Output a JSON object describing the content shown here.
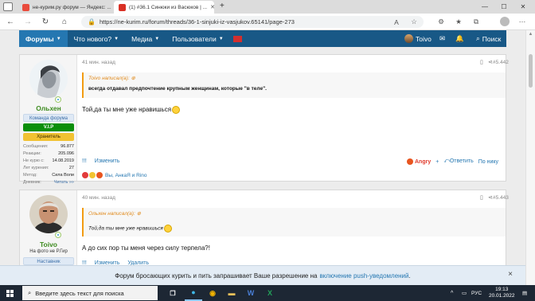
{
  "browser": {
    "tabs": [
      {
        "title": "не-курим.ру форум — Яндекс: ...",
        "active": false
      },
      {
        "title": "(1) #36.1 Синюки из Васюков | ...",
        "active": true
      }
    ],
    "new_tab": "+",
    "url": "https://ne-kurim.ru/forum/threads/36-1-sinjuki-iz-vasjukov.65141/page-273"
  },
  "site_nav": {
    "items": [
      "Форумы",
      "Что нового?",
      "Медиа",
      "Пользователи"
    ],
    "username": "Toivo",
    "search_label": "Поиск"
  },
  "posts": [
    {
      "time": "41 мин. назад",
      "number": "#5.442",
      "user": {
        "name": "Ольхен",
        "badges": [
          "Команда форума",
          "V.I.P",
          "Хранитель"
        ],
        "stats": [
          {
            "label": "Сообщения:",
            "value": "96.877"
          },
          {
            "label": "Реакции:",
            "value": "205.096"
          },
          {
            "label": "Не курю с:",
            "value": "14.08.2019"
          },
          {
            "label": "Лет курения:",
            "value": "27"
          },
          {
            "label": "Метод:",
            "value": "Сила Воли"
          },
          {
            "label": "Дневник:",
            "value": "Читать »»"
          }
        ]
      },
      "quote": {
        "author": "Toivo написал(а):",
        "text": "всегда отдавал предпочтение крупным женщинам, которые \"в теле\"."
      },
      "text": "Той,да ты мне уже нравишься",
      "actions": {
        "bars": "!!!",
        "edit": "Изменить",
        "reaction": "Angry",
        "plus": "+",
        "reply": "Ответить",
        "report": "По нику"
      },
      "reactions": "Вы, АнкаЯ и Rino"
    },
    {
      "time": "40 мин. назад",
      "number": "#5.443",
      "user": {
        "name": "Toivo",
        "title": "На фото не Р.Гир",
        "badges": [
          "Наставник"
        ]
      },
      "quote": {
        "author": "Ольхен написал(а):",
        "text": "Той,да ты мне уже нравишься"
      },
      "text": "А до сих пор ты меня через силу терпела?!",
      "actions": {
        "bars": "!!!",
        "edit": "Изменить",
        "delete": "Удалить"
      }
    }
  ],
  "notification": {
    "text": "Форум бросающих курить и пить запрашивает Ваше разрешение на",
    "link": "включение push-уведомлений",
    "end": ".",
    "close": "×"
  },
  "taskbar": {
    "search_placeholder": "Введите здесь текст для поиска",
    "lang": "РУС",
    "time": "19:13",
    "date": "20.01.2022"
  },
  "colors": {
    "nav_bg": "#185886",
    "accent_blue": "#2577b1",
    "username_green": "#3d8b1f",
    "quote_orange": "#e08a1c"
  }
}
